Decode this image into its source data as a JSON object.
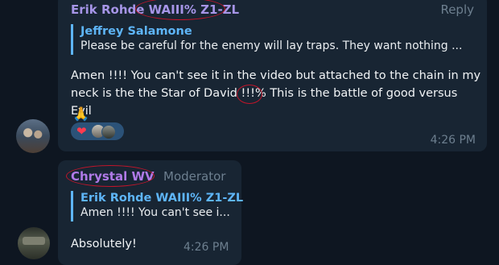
{
  "messages": [
    {
      "author": "Erik Rohde WAIII% Z1-ZL",
      "action": "Reply",
      "reply_to": {
        "author": "Jeffrey Salamone",
        "snippet": "Please be careful for the enemy will lay traps. They want nothing ..."
      },
      "text_line1": "Amen !!!! You can't see it in the video but attached to the chain in my",
      "text_line2_before": "neck is the the Star of David ",
      "text_line2_marked": "!!!%",
      "text_line2_after": " This is the battle of good versus Evil",
      "emoji": "🙏",
      "reaction": "❤",
      "time": "4:26 PM"
    },
    {
      "author": "Chrystal WV",
      "role": "Moderator",
      "reply_to": {
        "author": "Erik Rohde WAIII% Z1-ZL",
        "snippet": "Amen !!!! You can't see i..."
      },
      "text": "Absolutely!",
      "time": "4:26 PM"
    }
  ],
  "colors": {
    "background": "#0e1621",
    "bubble": "#182533",
    "accent": "#5eb5f7",
    "annotation_circle": "#c0152a"
  }
}
